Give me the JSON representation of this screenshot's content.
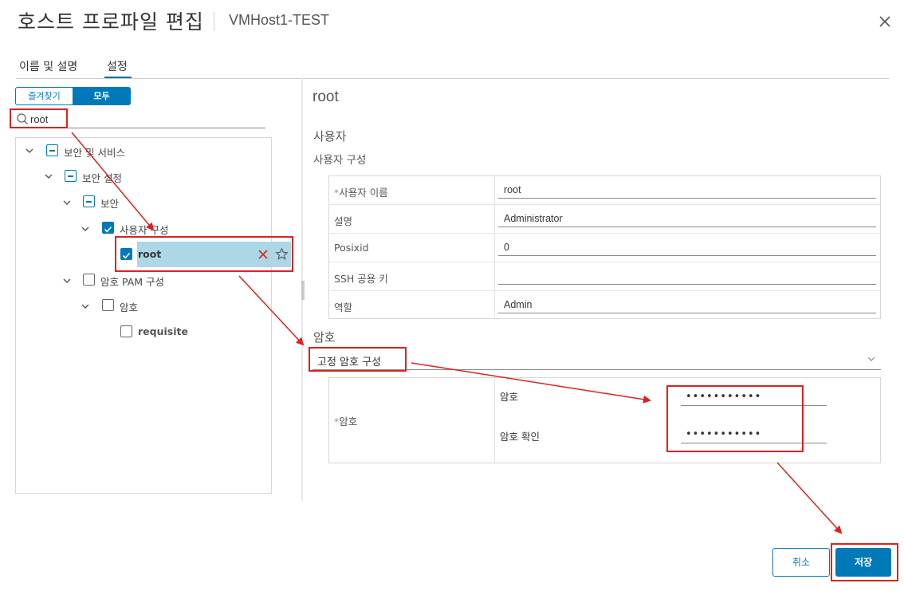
{
  "dialog": {
    "title": "호스트 프로파일 편집",
    "host": "VMHost1-TEST"
  },
  "tabs": [
    {
      "label": "이름 및 설명",
      "active": false
    },
    {
      "label": "설정",
      "active": true
    }
  ],
  "filter": {
    "favorites_label": "즐겨찾기",
    "all_label": "모두",
    "selected": "모두"
  },
  "search": {
    "value": "root"
  },
  "tree": {
    "items": [
      {
        "label": "보안 및 서비스",
        "state": "partial",
        "expanded": true
      },
      {
        "label": "보안 설정",
        "state": "partial",
        "expanded": true
      },
      {
        "label": "보안",
        "state": "partial",
        "expanded": true
      },
      {
        "label": "사용자 구성",
        "state": "checked",
        "expanded": true
      },
      {
        "label": "root",
        "state": "checked",
        "selected": true
      },
      {
        "label": "암호 PAM 구성",
        "state": "unchecked",
        "expanded": true
      },
      {
        "label": "암호",
        "state": "unchecked",
        "expanded": true
      },
      {
        "label": "requisite",
        "state": "unchecked"
      }
    ]
  },
  "detail": {
    "title": "root",
    "section_user": "사용자",
    "subsection_user_config": "사용자 구성",
    "fields": [
      {
        "label": "사용자 이름",
        "required": true,
        "value": "root"
      },
      {
        "label": "설명",
        "required": false,
        "value": "Administrator"
      },
      {
        "label": "Posixid",
        "required": false,
        "value": "0"
      },
      {
        "label": "SSH 공용 키",
        "required": false,
        "value": ""
      },
      {
        "label": "역할",
        "required": false,
        "value": "Admin"
      }
    ],
    "required_mark": "*",
    "section_password": "암호",
    "password_mode": "고정 암호 구성",
    "password_group_label": "암호",
    "password_label": "암호",
    "password_value": "•••••••••••",
    "confirm_label": "암호 확인",
    "confirm_value": "•••••••••••"
  },
  "buttons": {
    "cancel": "취소",
    "save": "저장"
  },
  "colors": {
    "accent": "#0079b8",
    "selection": "#abd7e6",
    "annotation": "#e02020"
  }
}
